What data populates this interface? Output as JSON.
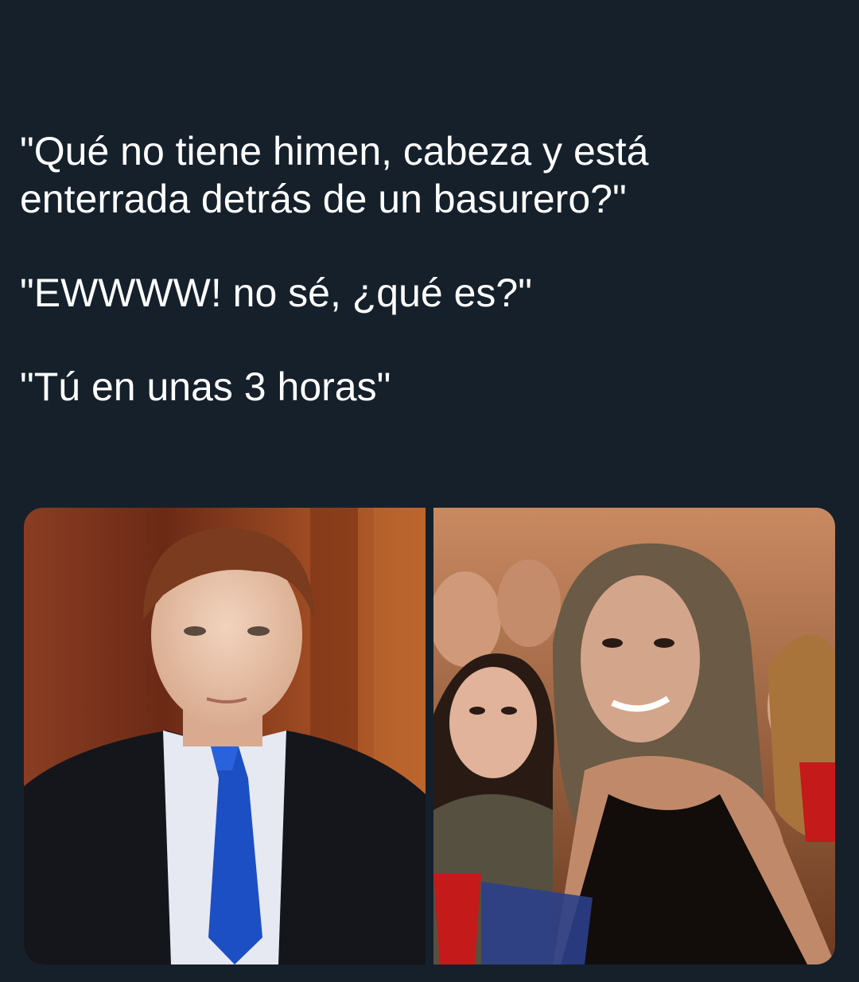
{
  "tweet": {
    "lines": [
      "\"Qué no tiene himen, cabeza y está\nenterrada detrás de un basurero?\"",
      "\"EWWWW! no sé, ¿qué es?\"",
      "\"Tú en unas 3 horas\""
    ]
  },
  "media": {
    "photos": [
      {
        "name": "young-man-in-suit-photo"
      },
      {
        "name": "party-girls-looking-back-photo"
      }
    ]
  },
  "colors": {
    "background": "#15202b",
    "text": "#ffffff"
  }
}
